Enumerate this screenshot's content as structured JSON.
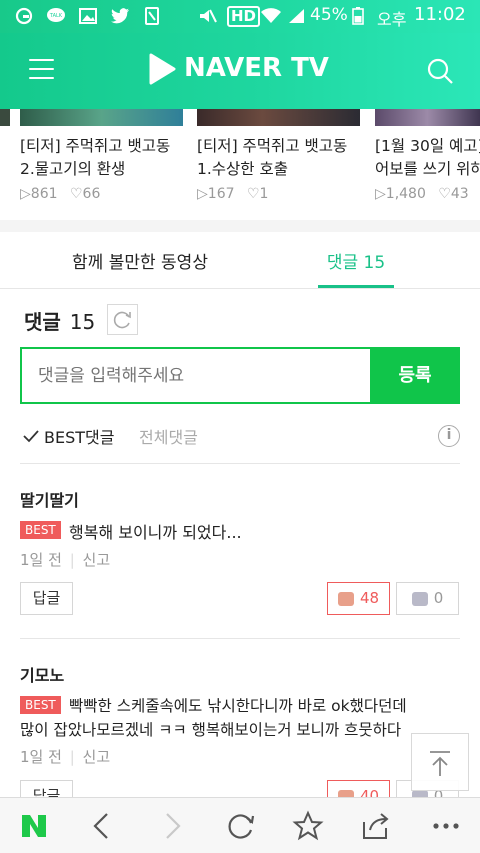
{
  "statusbar": {
    "battery": "45%",
    "ampm": "오후",
    "time": "11:02",
    "hd": "HD"
  },
  "header": {
    "brand": "NAVER TV"
  },
  "videos": [
    {
      "title1": "[티저] 주먹쥐고 뱃고동",
      "title2": "2.물고기의 환생",
      "views": "861",
      "likes": "66"
    },
    {
      "title1": "[티저] 주먹쥐고 뱃고동",
      "title2": "1.수상한 호출",
      "views": "167",
      "likes": "1"
    },
    {
      "title1": "[1월 30일 예고]",
      "title2": "어보를 쓰기 위하",
      "views": "1,480",
      "likes": "43"
    }
  ],
  "tabs": {
    "related": "함께 볼만한 동영상",
    "comments_label": "댓글",
    "comments_count": "15"
  },
  "comments_section": {
    "heading": "댓글",
    "count": "15",
    "input_placeholder": "댓글을 입력해주세요",
    "submit": "등록",
    "filter_best": "BEST댓글",
    "filter_all": "전체댓글"
  },
  "comments": [
    {
      "author": "딸기딸기",
      "badge": "BEST",
      "text": "행복해 보이니까 되었다...",
      "text2": "",
      "time": "1일 전",
      "report": "신고",
      "reply": "답글",
      "likes": "48",
      "dislikes": "0"
    },
    {
      "author": "기모노",
      "badge": "BEST",
      "text": "빡빡한 스케줄속에도 낚시한다니까 바로 ok했다던데",
      "text2": "많이 잡았나모르겠네 ㅋㅋ 행복해보이는거 보니까 흐뭇하다",
      "time": "1일 전",
      "report": "신고",
      "reply": "답글",
      "likes": "40",
      "dislikes": "0"
    }
  ],
  "colors": {
    "brand_green": "#1ec88a",
    "submit_green": "#10c54a",
    "best_red": "#ef5b5b",
    "tab_green": "#19c188"
  }
}
